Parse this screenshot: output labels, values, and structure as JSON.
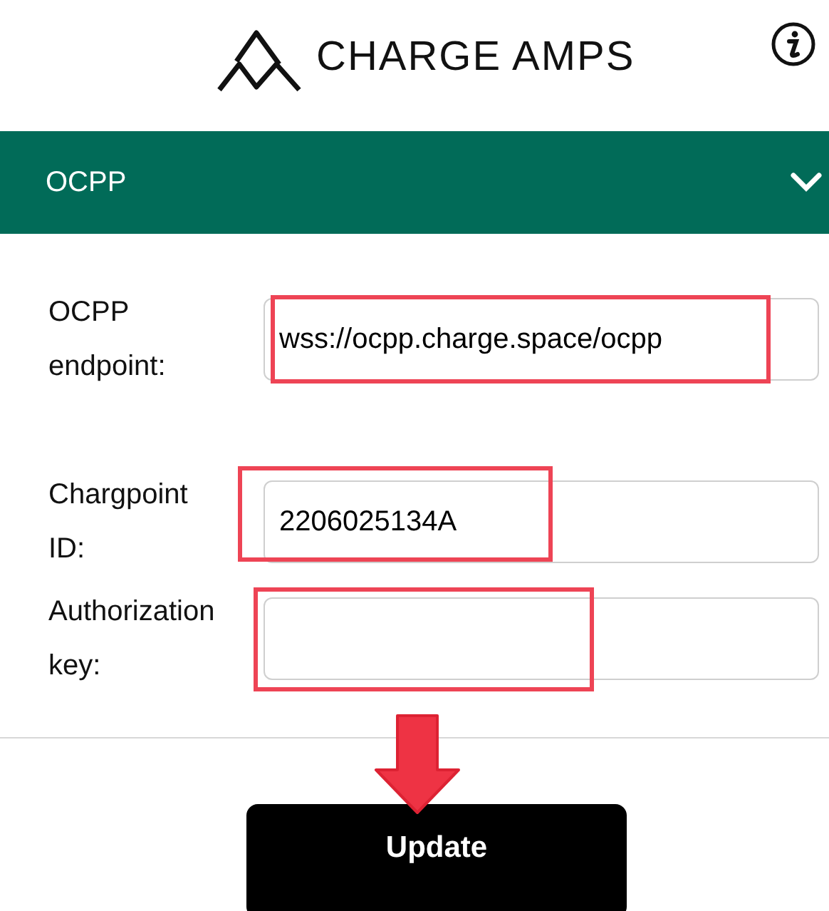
{
  "header": {
    "brand": "CHARGE AMPS"
  },
  "section": {
    "title": "OCPP",
    "expanded": true
  },
  "fields": [
    {
      "label": "OCPP endpoint:",
      "value": "wss://ocpp.charge.space/ocpp",
      "highlighted": true
    },
    {
      "label": "Chargpoint ID:",
      "value": "2206025134A",
      "highlighted": true
    },
    {
      "label": "Authorization key:",
      "highlighted": true
    }
  ],
  "button": {
    "label": "Update",
    "highlighted": true
  }
}
